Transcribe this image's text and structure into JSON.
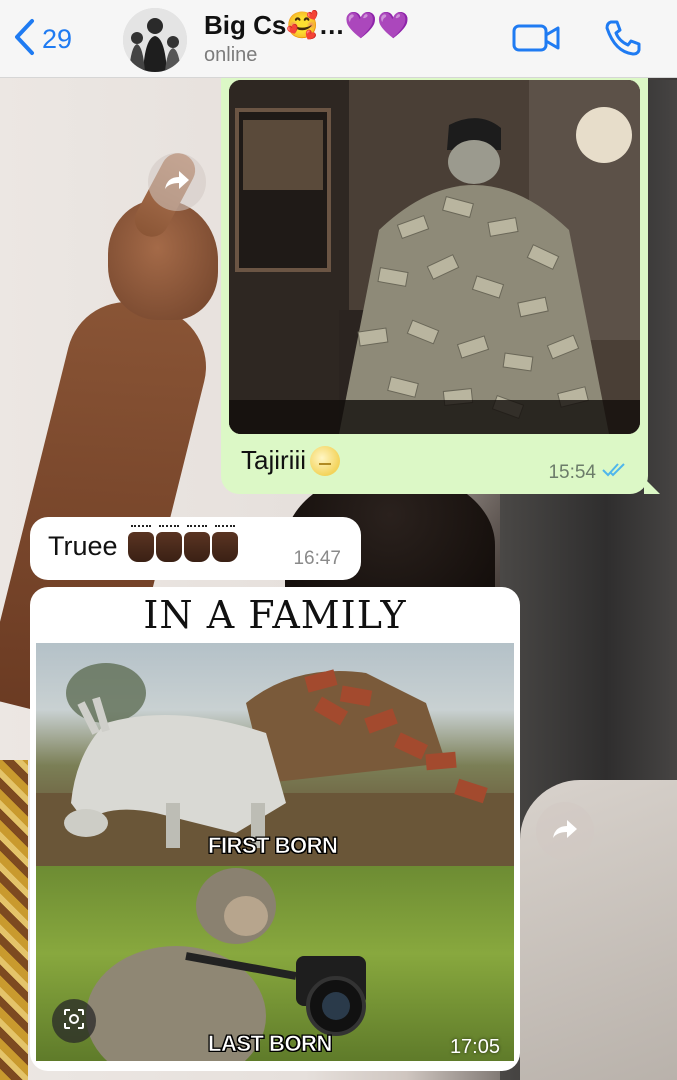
{
  "header": {
    "back_count": "29",
    "contact_name": "Big Cs🥰…💜💜",
    "status": "online"
  },
  "messages": [
    {
      "direction": "outgoing",
      "type": "image",
      "caption": "Tajiriii",
      "caption_emoji": "smiling-face-emoji",
      "time": "15:54",
      "read_status": "read"
    },
    {
      "direction": "incoming",
      "type": "text",
      "text": "Truee",
      "emoji": "raised-hands-emoji",
      "emoji_count": 4,
      "time": "16:47"
    },
    {
      "direction": "incoming",
      "type": "image",
      "meme": {
        "title": "IN A FAMILY",
        "top_label": "FIRST BORN",
        "bottom_label": "LAST BORN"
      },
      "time": "17:05"
    }
  ],
  "icons": [
    "chevron-left-icon",
    "video-camera-icon",
    "phone-icon",
    "forward-icon",
    "lens-icon",
    "double-check-icon"
  ],
  "colors": {
    "accent": "#1f7bf2",
    "outgoing_bubble": "#dcf8c6",
    "incoming_bubble": "#ffffff",
    "read_ticks": "#4fb6ec"
  }
}
